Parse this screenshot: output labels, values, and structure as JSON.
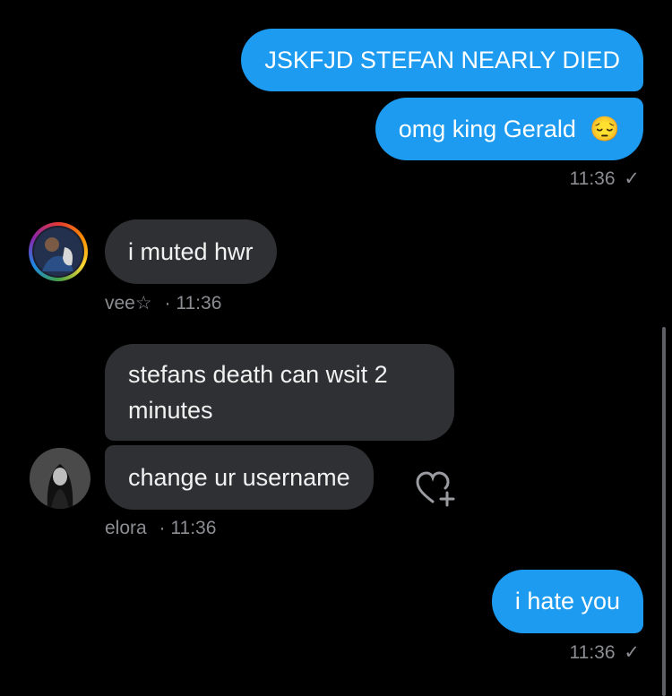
{
  "messages": [
    {
      "id": "m1",
      "text": "JSKFJD STEFAN NEARLY DIED",
      "dir": "out"
    },
    {
      "id": "m2",
      "text": "omg king Gerald",
      "emoji": "😔",
      "dir": "out"
    },
    {
      "id": "t1",
      "time": "11:36",
      "check": "✓"
    },
    {
      "id": "m3",
      "text": "i muted hwr",
      "dir": "in"
    },
    {
      "id": "u1",
      "user": "vee☆",
      "sep": "·",
      "time": "11:36"
    },
    {
      "id": "m4",
      "text": "stefans death can wsit 2 minutes",
      "dir": "in"
    },
    {
      "id": "m5",
      "text": "change ur username",
      "dir": "in"
    },
    {
      "id": "u2",
      "user": "elora",
      "sep": "·",
      "time": "11:36"
    },
    {
      "id": "m6",
      "text": "i hate you",
      "dir": "out"
    },
    {
      "id": "t2",
      "time": "11:36",
      "check": "✓"
    }
  ],
  "colors": {
    "out_bubble": "#1d9bf0",
    "in_bubble": "#2f3033",
    "background": "#000000",
    "meta": "#8b8d92"
  },
  "icons": {
    "react": "heart-plus-icon",
    "avatar1": "avatar-rainbow-ring",
    "avatar2": "avatar-grayscale"
  }
}
